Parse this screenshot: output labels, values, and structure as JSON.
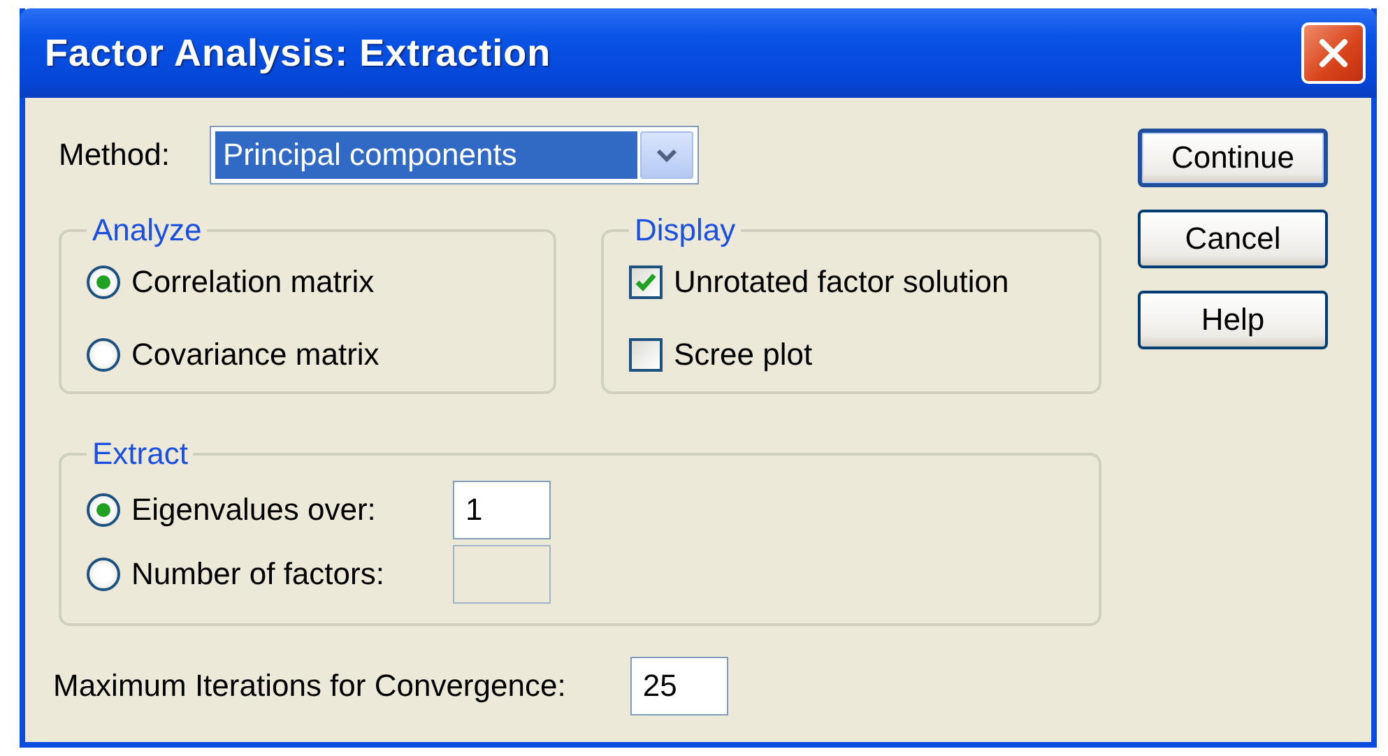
{
  "window": {
    "title": "Factor Analysis: Extraction"
  },
  "method": {
    "label": "Method:",
    "value": "Principal components"
  },
  "analyze": {
    "legend": "Analyze",
    "options": [
      {
        "label": "Correlation matrix",
        "selected": true
      },
      {
        "label": "Covariance matrix",
        "selected": false
      }
    ]
  },
  "display": {
    "legend": "Display",
    "options": [
      {
        "label": "Unrotated factor solution",
        "checked": true
      },
      {
        "label": "Scree plot",
        "checked": false
      }
    ]
  },
  "extract": {
    "legend": "Extract",
    "options": [
      {
        "label": "Eigenvalues over:",
        "selected": true,
        "value": "1",
        "disabled": false
      },
      {
        "label": "Number of factors:",
        "selected": false,
        "disabled": true
      }
    ]
  },
  "max_iterations": {
    "label": "Maximum Iterations for Convergence:",
    "value": "25"
  },
  "buttons": [
    {
      "label": "Continue",
      "default": true
    },
    {
      "label": "Cancel",
      "default": false
    },
    {
      "label": "Help",
      "default": false
    }
  ]
}
